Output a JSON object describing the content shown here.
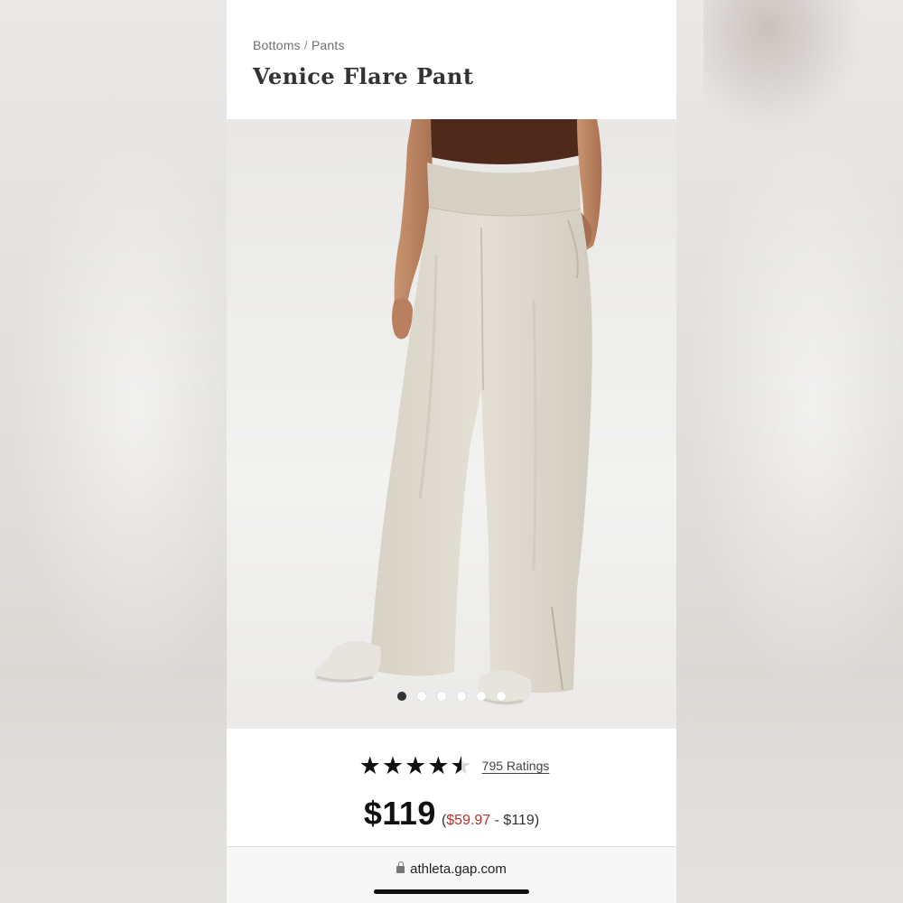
{
  "breadcrumb": {
    "category": "Bottoms",
    "separator": "/",
    "subcategory": "Pants"
  },
  "product": {
    "title": "Venice Flare Pant",
    "image_alt": "Model wearing Venice Flare Pant",
    "rating": 4.5,
    "rating_max": 5,
    "ratings_count_label": "795 Ratings",
    "price": "$119",
    "price_range_open": "(",
    "price_range_sale": "$59.97",
    "price_range_rest": " - $119)",
    "sale_color": "#b7312c"
  },
  "carousel": {
    "total": 6,
    "active_index": 0
  },
  "browser": {
    "url": "athleta.gap.com",
    "lock_icon": "lock-icon"
  }
}
